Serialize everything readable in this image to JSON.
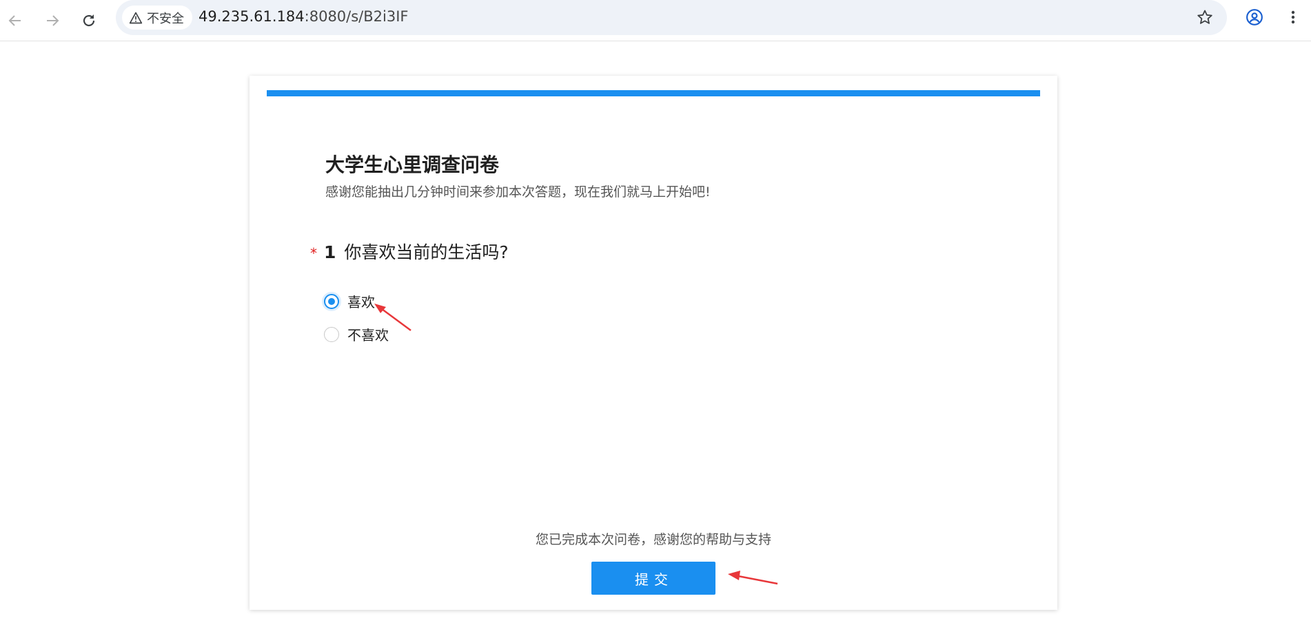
{
  "browser": {
    "security_label": "不安全",
    "url_host": "49.235.61.184",
    "url_rest": ":8080/s/B2i3IF"
  },
  "survey": {
    "progress_fraction": 1.0,
    "title": "大学生心里调查问卷",
    "subtitle": "感谢您能抽出几分钟时间来参加本次答题，现在我们就马上开始吧!",
    "question": {
      "required_mark": "*",
      "number": "1",
      "text": "你喜欢当前的生活吗?",
      "options": [
        {
          "label": "喜欢",
          "selected": true
        },
        {
          "label": "不喜欢",
          "selected": false
        }
      ]
    },
    "done_text": "您已完成本次问卷，感谢您的帮助与支持",
    "submit_label": "提交"
  },
  "colors": {
    "accent": "#1a8ff0",
    "annotation_arrow": "#e8373a"
  }
}
